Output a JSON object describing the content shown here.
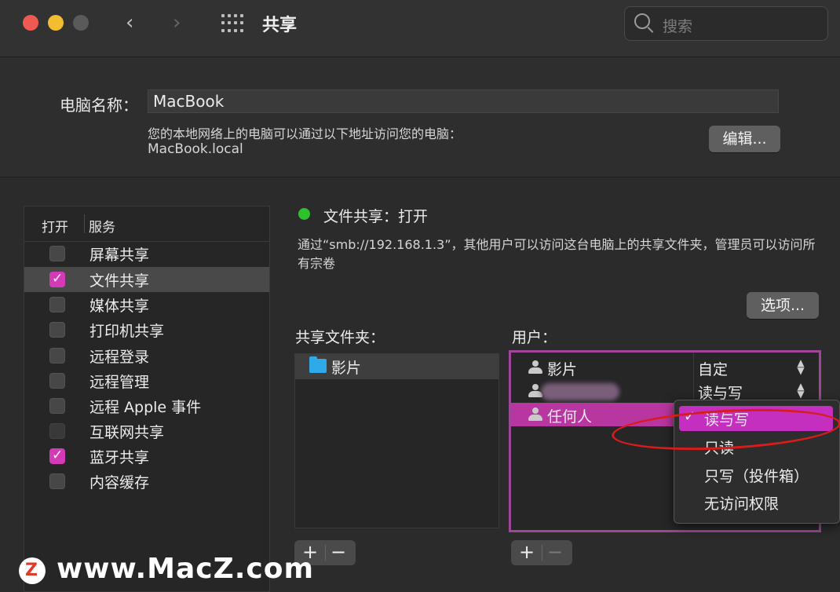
{
  "window": {
    "title": "共享",
    "search_placeholder": "搜索"
  },
  "computer": {
    "name_label": "电脑名称：",
    "name_value": "MacBook",
    "address_desc": "您的本地网络上的电脑可以通过以下地址访问您的电脑：",
    "address_host": "MacBook.local",
    "edit_button": "编辑..."
  },
  "services": {
    "col_on": "打开",
    "col_service": "服务",
    "items": [
      {
        "label": "屏幕共享",
        "checked": false
      },
      {
        "label": "文件共享",
        "checked": true,
        "selected": true
      },
      {
        "label": "媒体共享",
        "checked": false
      },
      {
        "label": "打印机共享",
        "checked": false
      },
      {
        "label": "远程登录",
        "checked": false
      },
      {
        "label": "远程管理",
        "checked": false
      },
      {
        "label": "远程 Apple 事件",
        "checked": false
      },
      {
        "label": "互联网共享",
        "checked": false
      },
      {
        "label": "蓝牙共享",
        "checked": true
      },
      {
        "label": "内容缓存",
        "checked": false
      }
    ]
  },
  "detail": {
    "status": "文件共享：打开",
    "status_color": "#2ec12e",
    "description": "通过“smb://192.168.1.3”，其他用户可以访问这台电脑上的共享文件夹，管理员可以访问所有宗卷",
    "options_button": "选项...",
    "folders_label": "共享文件夹：",
    "folders": [
      "影片"
    ],
    "users_label": "用户：",
    "users": [
      {
        "name": "影片",
        "permission": "自定"
      },
      {
        "name": "",
        "permission": "读与写"
      },
      {
        "name": "任何人",
        "permission": ""
      }
    ],
    "permission_menu": [
      {
        "label": "读与写",
        "checked": true
      },
      {
        "label": "只读",
        "checked": false
      },
      {
        "label": "只写（投件箱）",
        "checked": false
      },
      {
        "label": "无访问权限",
        "checked": false
      }
    ],
    "plus": "+",
    "minus": "−"
  },
  "watermark": {
    "logo_letter": "Z",
    "text": "www.MacZ.com"
  },
  "accent_color": "#d43ab8"
}
